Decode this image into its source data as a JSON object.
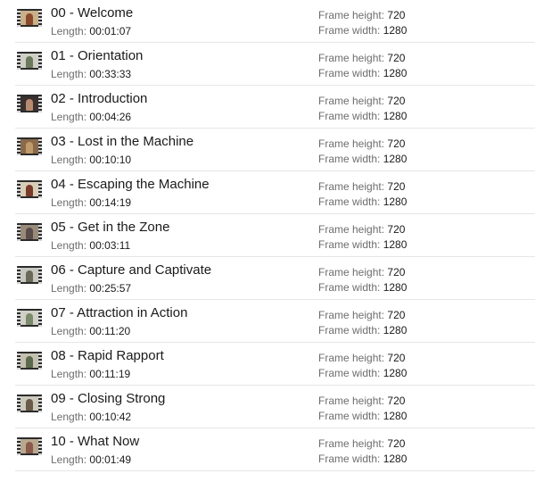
{
  "labels": {
    "length": "Length:",
    "frame_height": "Frame height:",
    "frame_width": "Frame width:"
  },
  "files": [
    {
      "name": "00 - Welcome",
      "length": "00:01:07",
      "frame_height": "720",
      "frame_width": "1280",
      "thumb_bg": "#c9b08a",
      "thumb_fg": "#8a4a2a"
    },
    {
      "name": "01 - Orientation",
      "length": "00:33:33",
      "frame_height": "720",
      "frame_width": "1280",
      "thumb_bg": "#cfcfc7",
      "thumb_fg": "#6a7a5a"
    },
    {
      "name": "02 - Introduction",
      "length": "00:04:26",
      "frame_height": "720",
      "frame_width": "1280",
      "thumb_bg": "#3a3030",
      "thumb_fg": "#b88a70"
    },
    {
      "name": "03 - Lost in the Machine",
      "length": "00:10:10",
      "frame_height": "720",
      "frame_width": "1280",
      "thumb_bg": "#8a6a4a",
      "thumb_fg": "#c09a6a"
    },
    {
      "name": "04 - Escaping the Machine",
      "length": "00:14:19",
      "frame_height": "720",
      "frame_width": "1280",
      "thumb_bg": "#d8cdb8",
      "thumb_fg": "#7a3a2a"
    },
    {
      "name": "05 - Get in the Zone",
      "length": "00:03:11",
      "frame_height": "720",
      "frame_width": "1280",
      "thumb_bg": "#9a8a7a",
      "thumb_fg": "#5a4a4a"
    },
    {
      "name": "06 - Capture and Captivate",
      "length": "00:25:57",
      "frame_height": "720",
      "frame_width": "1280",
      "thumb_bg": "#c8c8c0",
      "thumb_fg": "#6a6a5a"
    },
    {
      "name": "07 - Attraction in Action",
      "length": "00:11:20",
      "frame_height": "720",
      "frame_width": "1280",
      "thumb_bg": "#d0d0c8",
      "thumb_fg": "#7a8a6a"
    },
    {
      "name": "08 - Rapid Rapport",
      "length": "00:11:19",
      "frame_height": "720",
      "frame_width": "1280",
      "thumb_bg": "#c4c0b0",
      "thumb_fg": "#5a6a4a"
    },
    {
      "name": "09 - Closing Strong",
      "length": "00:10:42",
      "frame_height": "720",
      "frame_width": "1280",
      "thumb_bg": "#cccabc",
      "thumb_fg": "#6a5a4a"
    },
    {
      "name": "10 - What Now",
      "length": "00:01:49",
      "frame_height": "720",
      "frame_width": "1280",
      "thumb_bg": "#b8a890",
      "thumb_fg": "#8a5a4a"
    }
  ]
}
